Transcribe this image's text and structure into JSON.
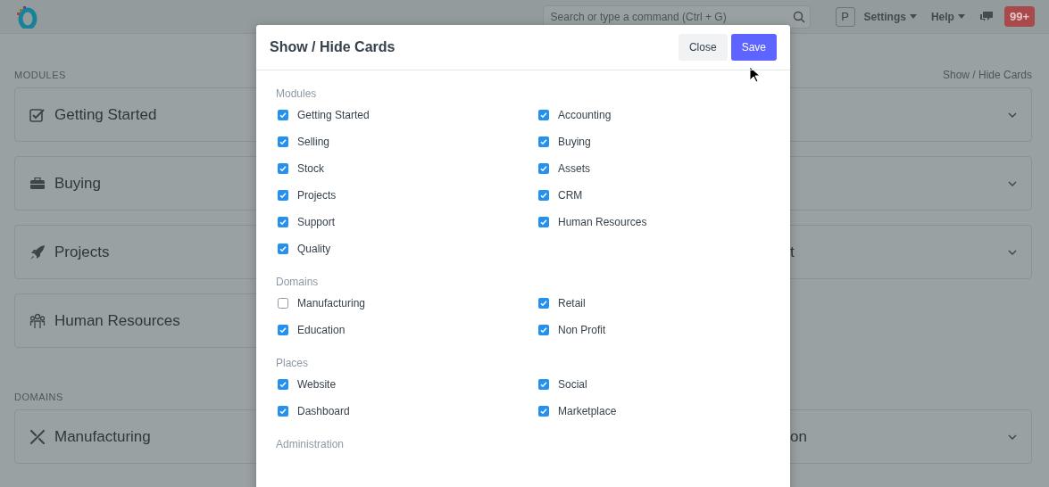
{
  "navbar": {
    "search_placeholder": "Search or type a command (Ctrl + G)",
    "avatar": "P",
    "menus": [
      "Settings",
      "Help"
    ],
    "notifications": "99+"
  },
  "page": {
    "link": "Show / Hide Cards",
    "sections": [
      {
        "label": "MODULES",
        "rows": [
          {
            "left": {
              "title": "Getting Started"
            },
            "right": {}
          },
          {
            "left": {
              "title": "Buying"
            },
            "right": {}
          },
          {
            "left": {
              "title": "Projects"
            },
            "right": {
              "title": "t"
            }
          },
          {
            "left": {
              "title": "Human Resources"
            }
          }
        ]
      },
      {
        "label": "DOMAINS",
        "rows": [
          {
            "left": {
              "title": "Manufacturing"
            },
            "right": {
              "title": "on"
            }
          }
        ]
      }
    ]
  },
  "modal": {
    "title": "Show / Hide Cards",
    "buttons": [
      {
        "label": "Close",
        "kind": "secondary"
      },
      {
        "label": "Save",
        "kind": "primary"
      }
    ],
    "sections": [
      {
        "heading": "Modules",
        "items": [
          {
            "label": "Getting Started",
            "checked": true
          },
          {
            "label": "Accounting",
            "checked": true
          },
          {
            "label": "Selling",
            "checked": true
          },
          {
            "label": "Buying",
            "checked": true
          },
          {
            "label": "Stock",
            "checked": true
          },
          {
            "label": "Assets",
            "checked": true
          },
          {
            "label": "Projects",
            "checked": true
          },
          {
            "label": "CRM",
            "checked": true
          },
          {
            "label": "Support",
            "checked": true
          },
          {
            "label": "Human Resources",
            "checked": true
          },
          {
            "label": "Quality",
            "checked": true
          }
        ]
      },
      {
        "heading": "Domains",
        "items": [
          {
            "label": "Manufacturing",
            "checked": false
          },
          {
            "label": "Retail",
            "checked": true
          },
          {
            "label": "Education",
            "checked": true
          },
          {
            "label": "Non Profit",
            "checked": true
          }
        ]
      },
      {
        "heading": "Places",
        "items": [
          {
            "label": "Website",
            "checked": true
          },
          {
            "label": "Social",
            "checked": true
          },
          {
            "label": "Dashboard",
            "checked": true
          },
          {
            "label": "Marketplace",
            "checked": true
          }
        ]
      },
      {
        "heading": "Administration"
      }
    ]
  }
}
